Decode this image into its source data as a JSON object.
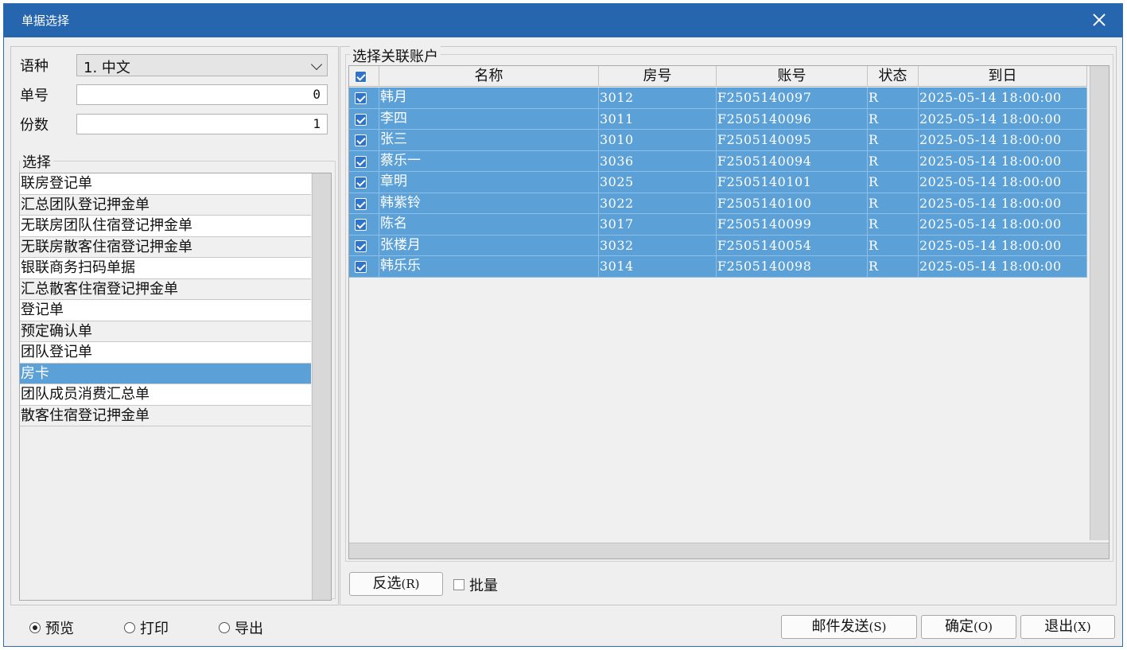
{
  "window": {
    "title": "单据选择"
  },
  "form": {
    "language_label": "语种",
    "language_value": "1. 中文",
    "number_label": "单号",
    "number_value": "0",
    "copies_label": "份数",
    "copies_value": "1"
  },
  "select_group": {
    "label": "选择",
    "items": [
      "联房登记单",
      "汇总团队登记押金单",
      "无联房团队住宿登记押金单",
      "无联房散客住宿登记押金单",
      "银联商务扫码单据",
      "汇总散客住宿登记押金单",
      "登记单",
      "预定确认单",
      "团队登记单",
      "房卡",
      "团队成员消费汇总单",
      "散客住宿登记押金单"
    ],
    "selected_item": "房卡"
  },
  "accounts": {
    "label": "选择关联账户",
    "columns": [
      "名称",
      "房号",
      "账号",
      "状态",
      "到日"
    ],
    "rows": [
      {
        "name": "韩月",
        "room": "3012",
        "account": "F2505140097",
        "status": "R",
        "arrival": "2025-05-14 18:00:00",
        "checked": true
      },
      {
        "name": "李四",
        "room": "3011",
        "account": "F2505140096",
        "status": "R",
        "arrival": "2025-05-14 18:00:00",
        "checked": true
      },
      {
        "name": "张三",
        "room": "3010",
        "account": "F2505140095",
        "status": "R",
        "arrival": "2025-05-14 18:00:00",
        "checked": true
      },
      {
        "name": "蔡乐一",
        "room": "3036",
        "account": "F2505140094",
        "status": "R",
        "arrival": "2025-05-14 18:00:00",
        "checked": true
      },
      {
        "name": "章明",
        "room": "3025",
        "account": "F2505140101",
        "status": "R",
        "arrival": "2025-05-14 18:00:00",
        "checked": true
      },
      {
        "name": "韩紫铃",
        "room": "3022",
        "account": "F2505140100",
        "status": "R",
        "arrival": "2025-05-14 18:00:00",
        "checked": true
      },
      {
        "name": "陈名",
        "room": "3017",
        "account": "F2505140099",
        "status": "R",
        "arrival": "2025-05-14 18:00:00",
        "checked": true
      },
      {
        "name": "张楼月",
        "room": "3032",
        "account": "F2505140054",
        "status": "R",
        "arrival": "2025-05-14 18:00:00",
        "checked": true
      },
      {
        "name": "韩乐乐",
        "room": "3014",
        "account": "F2505140098",
        "status": "R",
        "arrival": "2025-05-14 18:00:00",
        "checked": true
      }
    ]
  },
  "buttons": {
    "invert_label": "反选",
    "invert_key": "(R)",
    "batch_label": "批量",
    "email_label": "邮件发送",
    "email_key": "(S)",
    "ok_label": "确定",
    "ok_key": "(O)",
    "exit_label": "退出",
    "exit_key": "(X)"
  },
  "output_mode": {
    "options": [
      "预览",
      "打印",
      "导出"
    ],
    "selected": "预览"
  },
  "colors": {
    "title_bar": "#2566ae",
    "selection": "#5ba0d6",
    "checkbox": "#2f74c9"
  },
  "icons": [
    "close-icon",
    "chevron-down-icon"
  ]
}
